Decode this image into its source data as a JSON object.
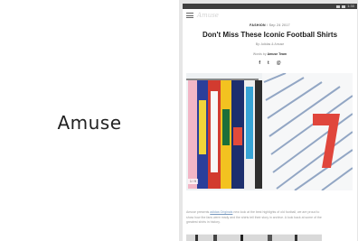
{
  "app": {
    "title": "Amuse"
  },
  "status_bar": {
    "time": "1:30"
  },
  "header": {
    "logo": "Amuse",
    "menu_icon": "hamburger-menu-icon"
  },
  "article": {
    "category": "FASHION",
    "date": "/ Sep 24 2017",
    "title": "Don't Miss These Iconic Football Shirts",
    "byline": "By: Adidas & Amuse",
    "author_prefix": "Words by",
    "author_name": "Amuse Team",
    "share_icons": [
      "facebook-icon",
      "twitter-icon",
      "email-icon"
    ],
    "share_glyphs": [
      "f",
      "t",
      "@"
    ],
    "image_caption": "1 / 9",
    "body_link": "adidas Originals",
    "body_before_link": "Amuse presents ",
    "body_after_link": " new look at the best highlights of old football, we are proud to show how",
    "body_line2": "the fans were ready and the shirts tell their story in archive. A look back at some of",
    "body_line3": "the greatest shirts in history."
  },
  "colors": {
    "status_bar": "#3f3f3f",
    "accent_red": "#e0463c",
    "link": "#7a9bc0"
  }
}
